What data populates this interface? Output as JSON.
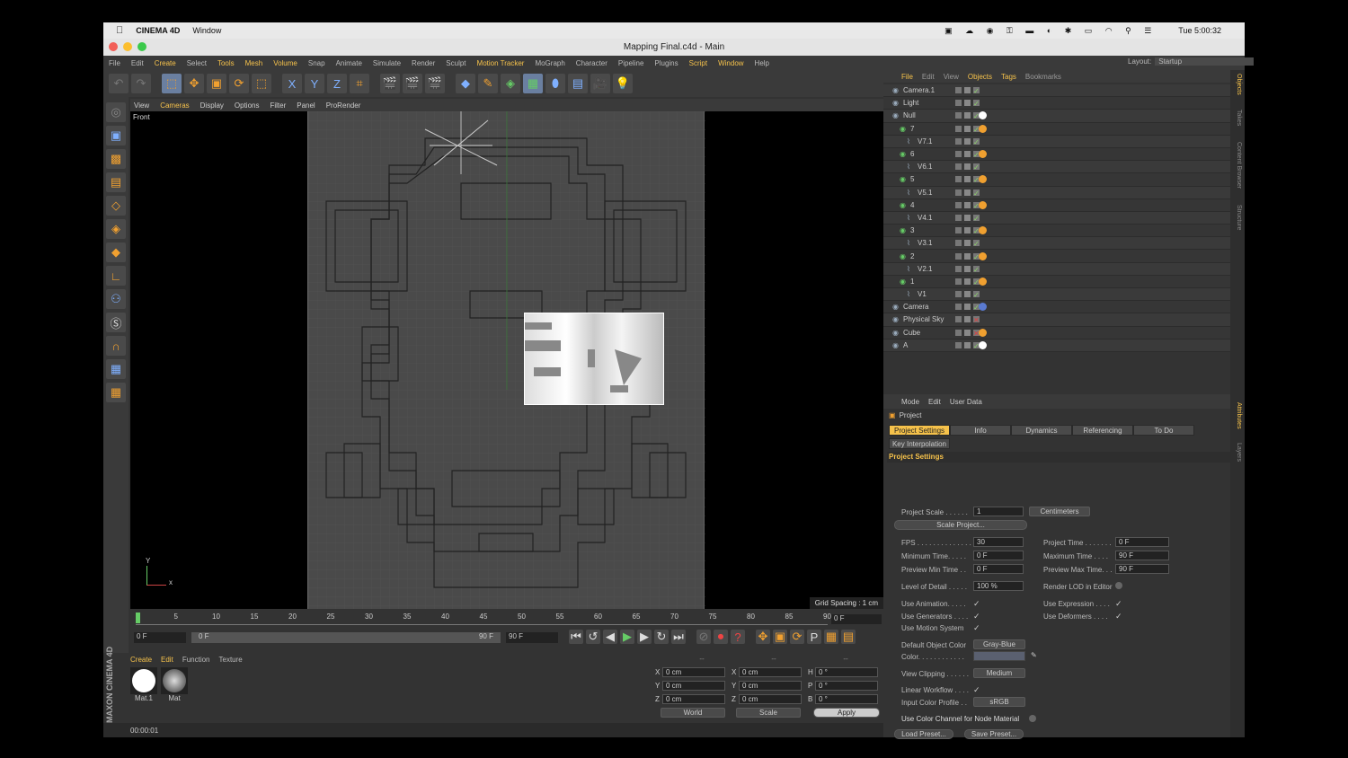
{
  "macmenu": {
    "apple": "",
    "app": "CINEMA 4D",
    "window": "Window",
    "clock": "Tue 5:00:32"
  },
  "title": "Mapping Final.c4d - Main",
  "menubar": [
    "File",
    "Edit",
    "Create",
    "Select",
    "Tools",
    "Mesh",
    "Volume",
    "Snap",
    "Animate",
    "Simulate",
    "Render",
    "Sculpt",
    "Motion Tracker",
    "MoGraph",
    "Character",
    "Pipeline",
    "Plugins",
    "Script",
    "Window",
    "Help"
  ],
  "menubar_hl": [
    "Create",
    "Tools",
    "Mesh",
    "Volume",
    "Motion Tracker",
    "Script",
    "Window"
  ],
  "layout": {
    "label": "Layout:",
    "value": "Startup"
  },
  "toolbar": {
    "x": "X",
    "y": "Y",
    "z": "Z"
  },
  "viewport": {
    "menu": [
      "View",
      "Cameras",
      "Display",
      "Options",
      "Filter",
      "Panel",
      "ProRender"
    ],
    "name": "Front",
    "grid_spacing": "Grid Spacing : 1 cm",
    "axis_y": "Y",
    "axis_x": "x"
  },
  "timeline": {
    "ticks": [
      "0",
      "5",
      "10",
      "15",
      "20",
      "25",
      "30",
      "35",
      "40",
      "45",
      "50",
      "55",
      "60",
      "65",
      "70",
      "75",
      "80",
      "85",
      "90"
    ],
    "end_field": "0 F",
    "start": "0 F",
    "range_start": "0 F",
    "range_end": "90 F",
    "max": "90 F"
  },
  "materials": {
    "menu": [
      "Create",
      "Edit",
      "Function",
      "Texture"
    ],
    "items": [
      "Mat.1",
      "Mat"
    ]
  },
  "coords": {
    "head": [
      "--",
      "--",
      "--"
    ],
    "rows": [
      [
        "X",
        "0 cm",
        "X",
        "0 cm",
        "H",
        "0 °"
      ],
      [
        "Y",
        "0 cm",
        "Y",
        "0 cm",
        "P",
        "0 °"
      ],
      [
        "Z",
        "0 cm",
        "Z",
        "0 cm",
        "B",
        "0 °"
      ]
    ],
    "world": "World",
    "scale": "Scale",
    "apply": "Apply"
  },
  "status": "00:00:01",
  "brand": "MAXON CINEMA 4D",
  "objects": {
    "menu": [
      "File",
      "Edit",
      "View",
      "Objects",
      "Tags",
      "Bookmarks"
    ],
    "rows": [
      {
        "name": "Camera.1",
        "indent": 0,
        "x": false
      },
      {
        "name": "Light",
        "indent": 0,
        "x": false
      },
      {
        "name": "Null",
        "indent": 0,
        "x": false,
        "tag": "white"
      },
      {
        "name": "7",
        "indent": 1,
        "x": false,
        "tag": "orange"
      },
      {
        "name": "V7.1",
        "indent": 2,
        "x": false
      },
      {
        "name": "6",
        "indent": 1,
        "x": false,
        "tag": "orange"
      },
      {
        "name": "V6.1",
        "indent": 2,
        "x": false
      },
      {
        "name": "5",
        "indent": 1,
        "x": false,
        "tag": "orange"
      },
      {
        "name": "V5.1",
        "indent": 2,
        "x": false
      },
      {
        "name": "4",
        "indent": 1,
        "x": false,
        "tag": "orange"
      },
      {
        "name": "V4.1",
        "indent": 2,
        "x": false
      },
      {
        "name": "3",
        "indent": 1,
        "x": false,
        "tag": "orange"
      },
      {
        "name": "V3.1",
        "indent": 2,
        "x": false
      },
      {
        "name": "2",
        "indent": 1,
        "x": false,
        "tag": "orange"
      },
      {
        "name": "V2.1",
        "indent": 2,
        "x": false
      },
      {
        "name": "1",
        "indent": 1,
        "x": false,
        "tag": "orange"
      },
      {
        "name": "V1",
        "indent": 2,
        "x": false
      },
      {
        "name": "Camera",
        "indent": 0,
        "x": false,
        "tag": "blue"
      },
      {
        "name": "Physical Sky",
        "indent": 0,
        "x": true
      },
      {
        "name": "Cube",
        "indent": 0,
        "x": true,
        "tag": "orange"
      },
      {
        "name": "A",
        "indent": 0,
        "x": false,
        "tag": "white"
      }
    ]
  },
  "attributes": {
    "menu": [
      "Mode",
      "Edit",
      "User Data"
    ],
    "object": "Project",
    "tabs": [
      "Project Settings",
      "Info",
      "Dynamics",
      "Referencing",
      "To Do"
    ],
    "tab2": "Key Interpolation",
    "section": "Project Settings",
    "project_scale_label": "Project Scale . . . . . .",
    "project_scale": "1",
    "unit": "Centimeters",
    "scale_btn": "Scale Project...",
    "fps_label": "FPS . . . . . . . . . . . . . .",
    "fps": "30",
    "ptime_label": "Project Time . . . . . . .",
    "ptime": "0 F",
    "mintime_label": "Minimum Time. . . . .",
    "mintime": "0 F",
    "maxtime_label": "Maximum Time . . . .",
    "maxtime": "90 F",
    "pmin_label": "Preview Min Time . .",
    "pmin": "0 F",
    "pmax_label": "Preview Max Time. . .",
    "pmax": "90 F",
    "lod_label": "Level of Detail . . . . .",
    "lod": "100 %",
    "rlod_label": "Render LOD in Editor",
    "useanim": "Use Animation. . . . .",
    "useexpr": "Use Expression . . . .",
    "usegen": "Use Generators . . . .",
    "usedef": "Use Deformers . . . .",
    "usemotion": "Use Motion System",
    "defcolor_label": "Default Object Color",
    "defcolor": "Gray-Blue",
    "color_label": "Color. . . . . . . . . . . .",
    "viewclip_label": "View Clipping . . . . . .",
    "viewclip": "Medium",
    "linear_label": "Linear Workflow . . . .",
    "icp_label": "Input Color Profile . .",
    "icp": "sRGB",
    "usenode": "Use Color Channel for Node Material",
    "load": "Load Preset...",
    "save": "Save Preset..."
  },
  "rightstrip": [
    "Objects",
    "Takes",
    "Content Browser",
    "Structure",
    "Attributes",
    "Layers"
  ]
}
